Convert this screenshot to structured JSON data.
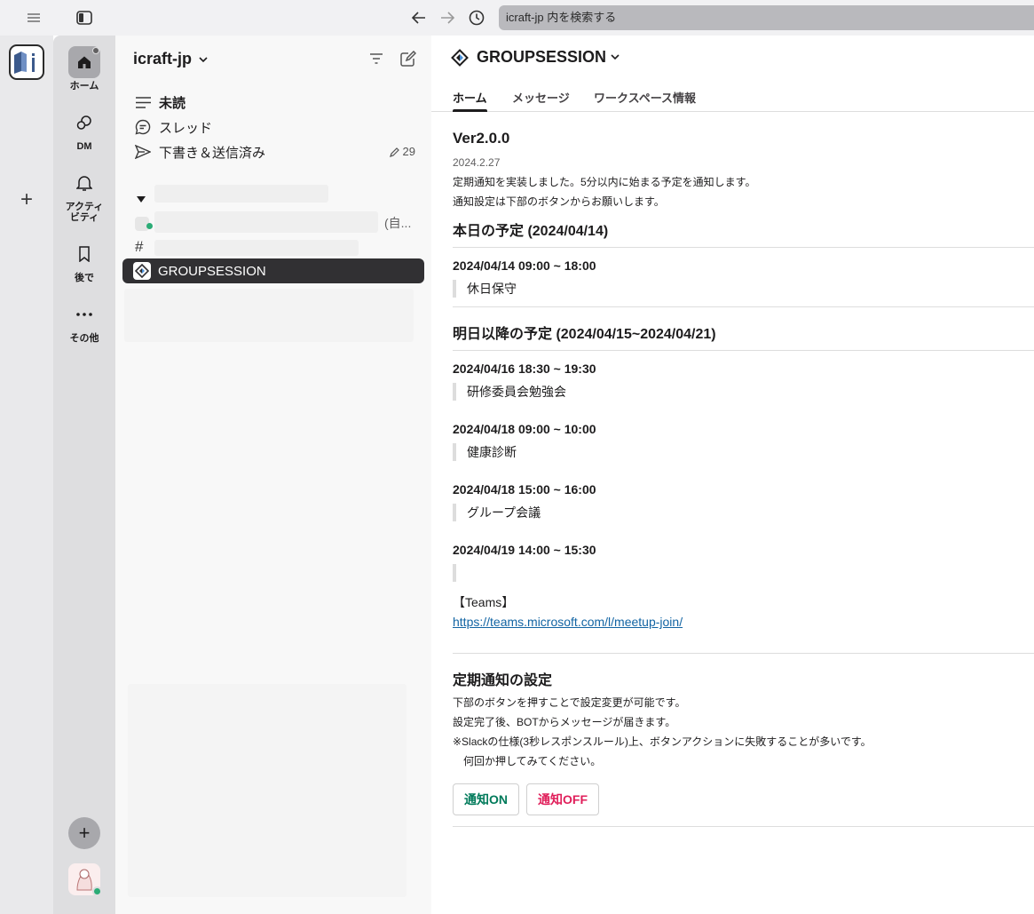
{
  "topbar": {
    "search_placeholder": "icraft-jp 内を検索する"
  },
  "nav": {
    "home": "ホーム",
    "dm": "DM",
    "activity": "アクティビティ",
    "later": "後で",
    "more": "その他"
  },
  "sidebar": {
    "workspace_name": "icraft-jp",
    "links": [
      {
        "label": "未読"
      },
      {
        "label": "スレッド"
      },
      {
        "label": "下書き＆送信済み"
      }
    ],
    "draft_count": "29",
    "dm_self": "(自...",
    "channel_hash": "#",
    "active_channel": "GROUPSESSION"
  },
  "main": {
    "channel_title": "GROUPSESSION",
    "tabs": [
      "ホーム",
      "メッセージ",
      "ワークスペース情報"
    ],
    "version": "Ver2.0.0",
    "date": "2024.2.27",
    "release_lines": [
      "定期通知を実装しました。5分以内に始まる予定を通知します。",
      "通知設定は下部のボタンからお願いします。"
    ],
    "today_heading": "本日の予定 (2024/04/14)",
    "today_events": [
      {
        "time": "2024/04/14 09:00 ~ 18:00",
        "title": "休日保守"
      }
    ],
    "future_heading": "明日以降の予定 (2024/04/15~2024/04/21)",
    "future_events": [
      {
        "time": "2024/04/16 18:30 ~ 19:30",
        "title": "研修委員会勉強会"
      },
      {
        "time": "2024/04/18 09:00 ~ 10:00",
        "title": "健康診断"
      },
      {
        "time": "2024/04/18 15:00 ~ 16:00",
        "title": "グループ会議"
      },
      {
        "time": "2024/04/19 14:00 ~ 15:30",
        "title": ""
      }
    ],
    "teams_label": "【Teams】",
    "teams_link": "https://teams.microsoft.com/l/meetup-join/",
    "settings_heading": "定期通知の設定",
    "settings_lines": [
      "下部のボタンを押すことで設定変更が可能です。",
      "設定完了後、BOTからメッセージが届きます。",
      "※Slackの仕様(3秒レスポンスルール)上、ボタンアクションに失敗することが多いです。",
      "　何回か押してみてください。"
    ],
    "btn_on": "通知ON",
    "btn_off": "通知OFF"
  }
}
